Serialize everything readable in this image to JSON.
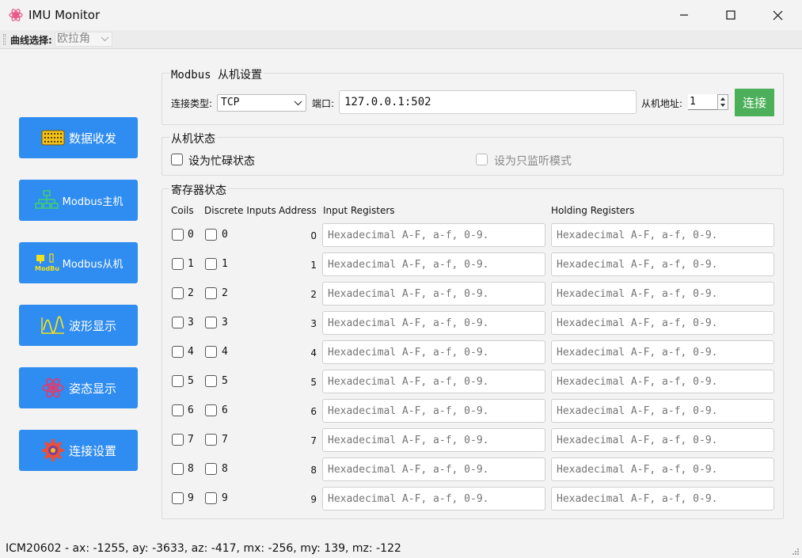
{
  "window": {
    "title": "IMU Monitor",
    "icons": {
      "app": "molecule-icon",
      "minimize": "minimize-icon",
      "maximize": "maximize-icon",
      "close": "close-icon"
    }
  },
  "toolbar": {
    "curve_label": "曲线选择:",
    "curve_value": "欧拉角"
  },
  "sidebar": {
    "items": [
      {
        "label": "数据收发",
        "icon": "data-board-icon"
      },
      {
        "label": "Modbus主机",
        "icon": "network-tree-icon"
      },
      {
        "label": "Modbus从机",
        "icon": "modbus-device-icon"
      },
      {
        "label": "波形显示",
        "icon": "waveform-icon"
      },
      {
        "label": "姿态显示",
        "icon": "atom-icon"
      },
      {
        "label": "连接设置",
        "icon": "gear-icon"
      }
    ]
  },
  "slave_settings": {
    "title": "Modbus 从机设置",
    "conn_type_label": "连接类型:",
    "conn_type_value": "TCP",
    "port_label": "端口:",
    "port_value": "127.0.0.1:502",
    "slave_addr_label": "从机地址:",
    "slave_addr_value": "1",
    "connect_label": "连接"
  },
  "slave_state": {
    "title": "从机状态",
    "busy_label": "设为忙碌状态",
    "listen_label": "设为只监听模式"
  },
  "registers": {
    "title": "寄存器状态",
    "headers": {
      "coils": "Coils",
      "discrete": "Discrete Inputs",
      "address": "Address",
      "input": "Input Registers",
      "holding": "Holding Registers"
    },
    "placeholder": "Hexadecimal A-F, a-f, 0-9.",
    "rows": [
      {
        "coil": "0",
        "discrete": "0",
        "address": "0"
      },
      {
        "coil": "1",
        "discrete": "1",
        "address": "1"
      },
      {
        "coil": "2",
        "discrete": "2",
        "address": "2"
      },
      {
        "coil": "3",
        "discrete": "3",
        "address": "3"
      },
      {
        "coil": "4",
        "discrete": "4",
        "address": "4"
      },
      {
        "coil": "5",
        "discrete": "5",
        "address": "5"
      },
      {
        "coil": "6",
        "discrete": "6",
        "address": "6"
      },
      {
        "coil": "7",
        "discrete": "7",
        "address": "7"
      },
      {
        "coil": "8",
        "discrete": "8",
        "address": "8"
      },
      {
        "coil": "9",
        "discrete": "9",
        "address": "9"
      }
    ]
  },
  "status": {
    "text": "ICM20602 - ax: -1255, ay: -3633, az: -417, mx: -256, my: 139, mz: -122"
  },
  "colors": {
    "nav_button": "#2f8cf0",
    "connect_button": "#4cb05a"
  }
}
